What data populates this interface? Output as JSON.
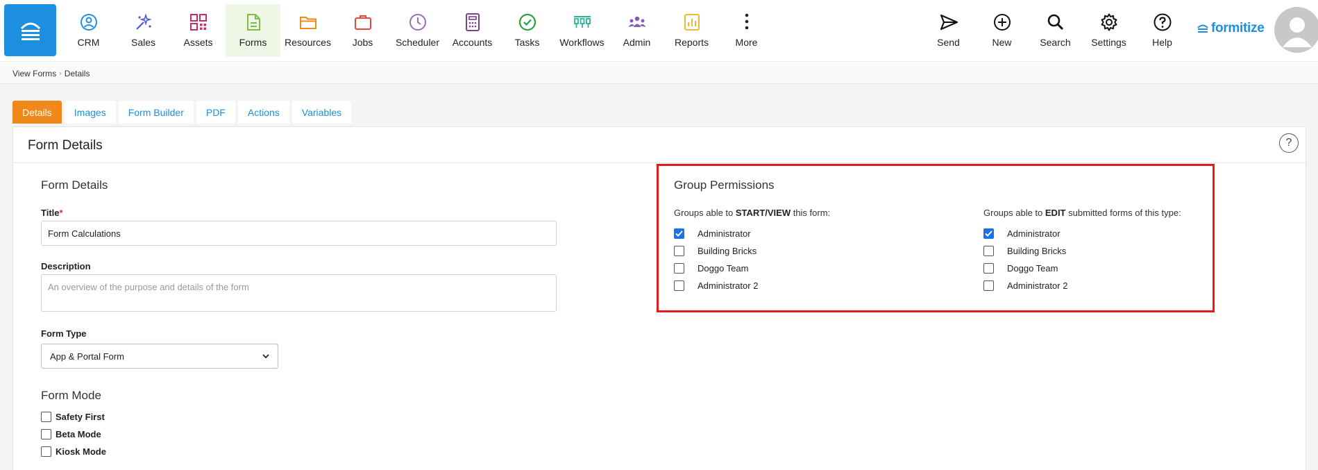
{
  "nav": {
    "items": [
      {
        "label": "CRM",
        "icon": "crm-face-icon",
        "color": "#1c8fe0"
      },
      {
        "label": "Sales",
        "icon": "sales-sparkle-icon",
        "color": "#4a5bd4"
      },
      {
        "label": "Assets",
        "icon": "qr-code-icon",
        "color": "#c0306e"
      },
      {
        "label": "Forms",
        "icon": "document-icon",
        "color": "#7bc043"
      },
      {
        "label": "Resources",
        "icon": "folder-icon",
        "color": "#f0891a"
      },
      {
        "label": "Jobs",
        "icon": "briefcase-icon",
        "color": "#e8473b"
      },
      {
        "label": "Scheduler",
        "icon": "clock-icon",
        "color": "#9b6bb8"
      },
      {
        "label": "Accounts",
        "icon": "calculator-icon",
        "color": "#7b3f8f"
      },
      {
        "label": "Tasks",
        "icon": "check-circle-icon",
        "color": "#2e9e44"
      },
      {
        "label": "Workflows",
        "icon": "workflow-icon",
        "color": "#2ab39a"
      },
      {
        "label": "Admin",
        "icon": "team-icon",
        "color": "#8a5bb5"
      },
      {
        "label": "Reports",
        "icon": "bar-chart-icon",
        "color": "#f5b731"
      },
      {
        "label": "More",
        "icon": "more-dots-icon",
        "color": "#222222"
      }
    ],
    "active": "Forms"
  },
  "right_nav": [
    {
      "label": "Send",
      "icon": "send-icon"
    },
    {
      "label": "New",
      "icon": "plus-circle-icon"
    },
    {
      "label": "Search",
      "icon": "search-icon"
    },
    {
      "label": "Settings",
      "icon": "gear-icon"
    },
    {
      "label": "Help",
      "icon": "help-icon"
    }
  ],
  "brand": "formitize",
  "breadcrumb": [
    "View Forms",
    "Details"
  ],
  "tabs": [
    "Details",
    "Images",
    "Form Builder",
    "PDF",
    "Actions",
    "Variables"
  ],
  "active_tab": "Details",
  "card": {
    "title": "Form Details",
    "help": "?"
  },
  "form_details": {
    "section_title": "Form Details",
    "title_label": "Title",
    "required_mark": "*",
    "title_value": "Form Calculations",
    "description_label": "Description",
    "description_placeholder": "An overview of the purpose and details of the form",
    "form_type_label": "Form Type",
    "form_type_value": "App & Portal Form"
  },
  "form_mode": {
    "title": "Form Mode",
    "options": [
      {
        "label": "Safety First",
        "checked": false
      },
      {
        "label": "Beta Mode",
        "checked": false
      },
      {
        "label": "Kiosk Mode",
        "checked": false
      }
    ]
  },
  "permissions": {
    "title": "Group Permissions",
    "start_view": {
      "prefix": "Groups able to ",
      "emphasis": "START/VIEW",
      "suffix": " this form:",
      "groups": [
        {
          "label": "Administrator",
          "checked": true
        },
        {
          "label": "Building Bricks",
          "checked": false
        },
        {
          "label": "Doggo Team",
          "checked": false
        },
        {
          "label": "Administrator 2",
          "checked": false
        }
      ]
    },
    "edit": {
      "prefix": "Groups able to ",
      "emphasis": "EDIT",
      "suffix": " submitted forms of this type:",
      "groups": [
        {
          "label": "Administrator",
          "checked": true
        },
        {
          "label": "Building Bricks",
          "checked": false
        },
        {
          "label": "Doggo Team",
          "checked": false
        },
        {
          "label": "Administrator 2",
          "checked": false
        }
      ]
    }
  }
}
